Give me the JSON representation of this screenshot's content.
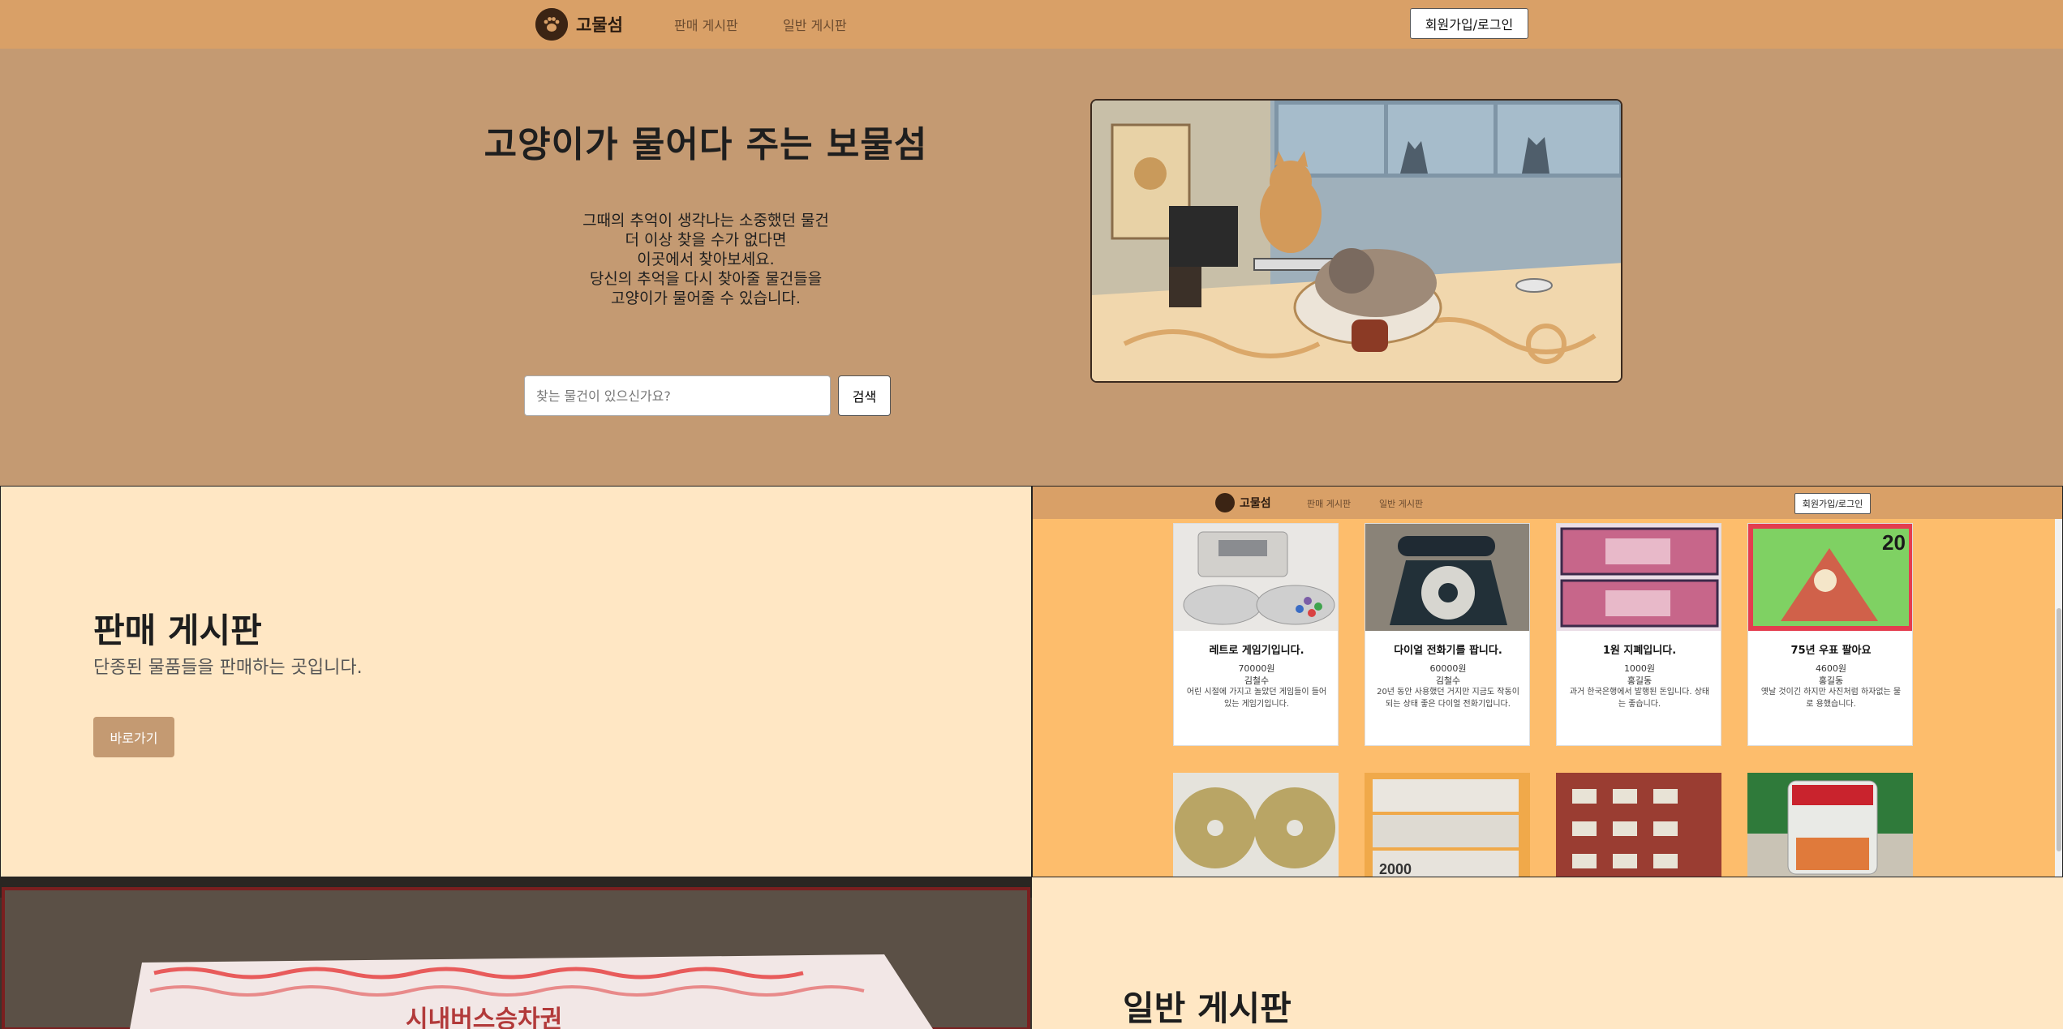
{
  "nav": {
    "brand": "고물섬",
    "links": [
      "판매 게시판",
      "일반 게시판"
    ],
    "login": "회원가입/로그인"
  },
  "hero": {
    "title": "고양이가 물어다 주는 보물섬",
    "description": [
      "그때의 추억이 생각나는 소중했던 물건",
      "더 이상 찾을 수가 없다면",
      "이곳에서 찾아보세요.",
      "당신의 추억을 다시 찾아줄 물건들을",
      "고양이가 물어줄 수 있습니다."
    ],
    "search_placeholder": "찾는 물건이 있으신가요?",
    "search_button": "검색"
  },
  "sale_board": {
    "title": "판매 게시판",
    "subtitle": "단종된 물품들을 판매하는 곳입니다.",
    "button": "바로가기"
  },
  "preview": {
    "brand": "고물섬",
    "links": [
      "판매 게시판",
      "일반 게시판"
    ],
    "login": "회원가입/로그인",
    "products": [
      {
        "title": "레트로 게임기입니다.",
        "price": "70000원",
        "seller": "김철수",
        "desc": "어린 시절에 가지고 놀았던 게임들이 들어있는 게임기입니다."
      },
      {
        "title": "다이얼 전화기를 팝니다.",
        "price": "60000원",
        "seller": "김철수",
        "desc": "20년 동안 사용했던 거지만 지금도 작동이 되는 상태 좋은 다이얼 전화기입니다."
      },
      {
        "title": "1원 지폐입니다.",
        "price": "1000원",
        "seller": "홍길동",
        "desc": "과거 한국은행에서 발행된 돈입니다. 상태는 좋습니다."
      },
      {
        "title": "75년 우표 팔아요",
        "price": "4600원",
        "seller": "홍길동",
        "desc": "옛날 것이긴 하지만 사진처럼 하자없는 물로 용했습니다."
      }
    ],
    "stamp_value": "20",
    "banknote_value": "2000"
  },
  "bus_ticket_text": "시내버스승차권",
  "general_board": {
    "title": "일반 게시판"
  },
  "colors": {
    "navbar": "#d9a067",
    "hero_bg": "#c49a72",
    "section_bg": "#ffe7c4",
    "preview_bg": "#fdbd6c",
    "accent_button": "#c49a72"
  }
}
